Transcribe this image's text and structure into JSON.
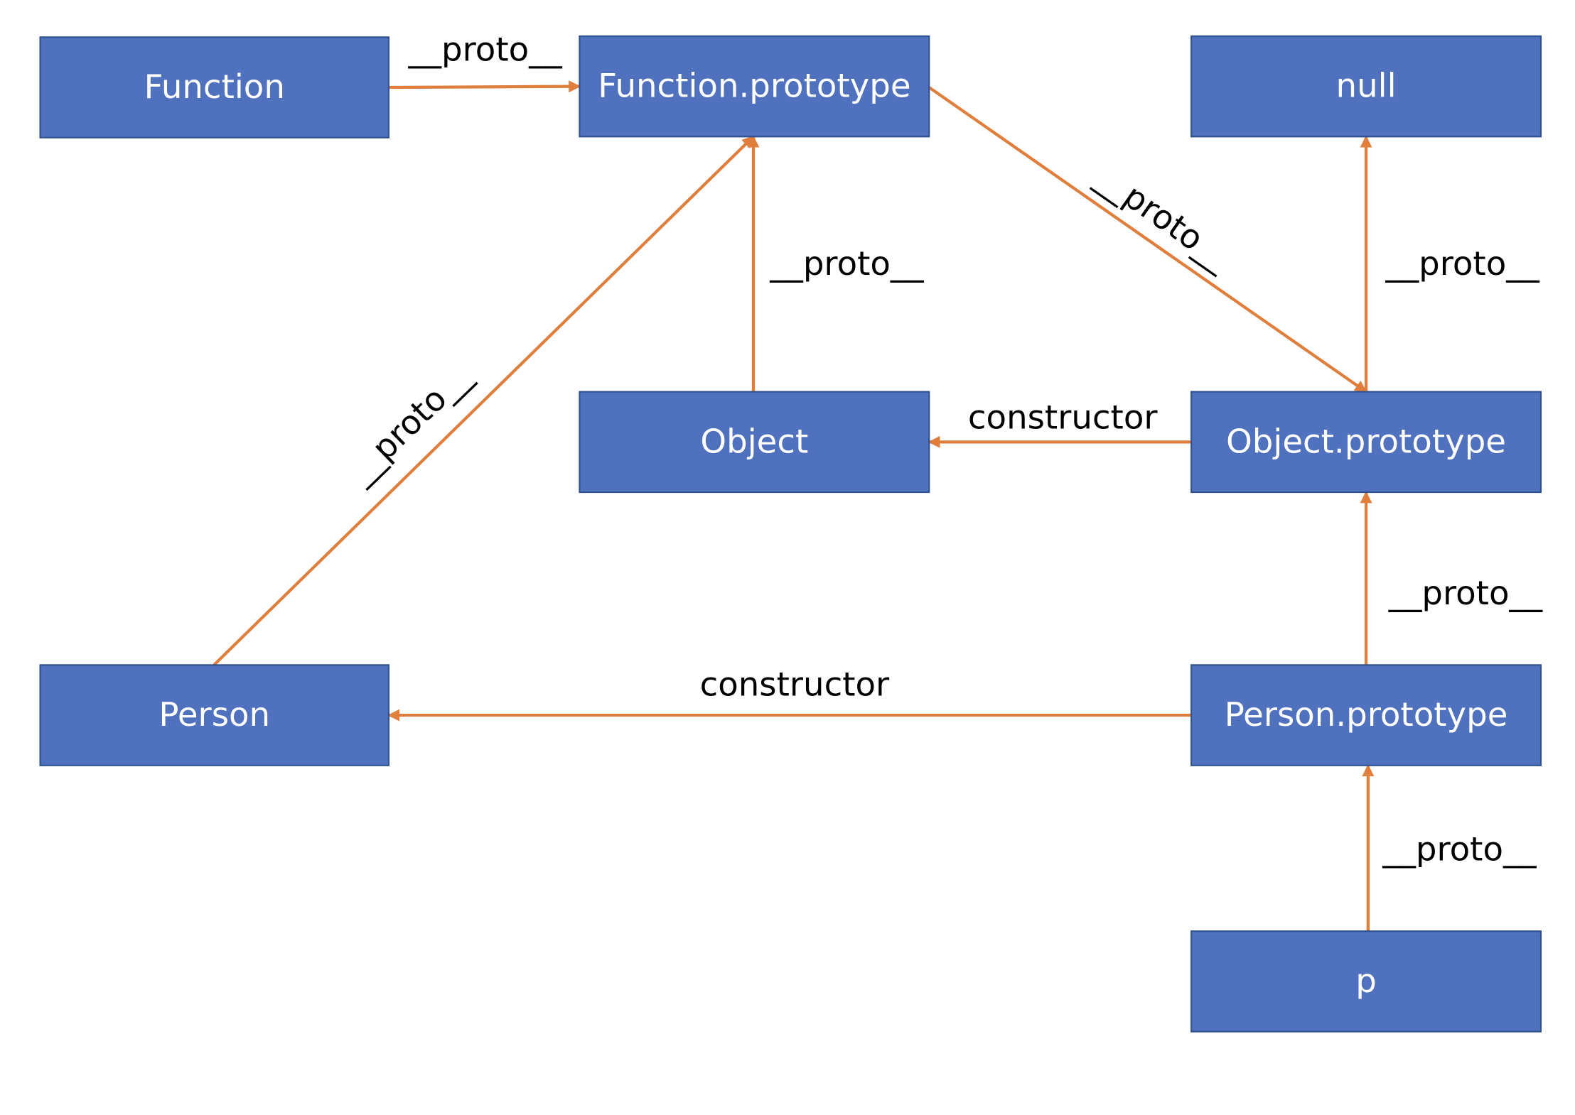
{
  "colors": {
    "box_fill": "#4F71BE",
    "box_border": "#2F528F",
    "arrow": "#E07E3C",
    "label": "#000000"
  },
  "nodes": [
    {
      "id": "function",
      "label": "Function"
    },
    {
      "id": "function_prototype",
      "label": "Function.prototype"
    },
    {
      "id": "null",
      "label": "null"
    },
    {
      "id": "object",
      "label": "Object"
    },
    {
      "id": "object_prototype",
      "label": "Object.prototype"
    },
    {
      "id": "person",
      "label": "Person"
    },
    {
      "id": "person_prototype",
      "label": "Person.prototype"
    },
    {
      "id": "p",
      "label": "p"
    }
  ],
  "edges": [
    {
      "from": "function",
      "to": "function_prototype",
      "label": "__proto__"
    },
    {
      "from": "function_prototype",
      "to": "object_prototype",
      "label": "__proto__"
    },
    {
      "from": "object",
      "to": "function_prototype",
      "label": "__proto__"
    },
    {
      "from": "person",
      "to": "function_prototype",
      "label": "__proto__"
    },
    {
      "from": "object_prototype",
      "to": "null",
      "label": "__proto__"
    },
    {
      "from": "object_prototype",
      "to": "object",
      "label": "constructor"
    },
    {
      "from": "person_prototype",
      "to": "object_prototype",
      "label": "__proto__"
    },
    {
      "from": "person_prototype",
      "to": "person",
      "label": "constructor"
    },
    {
      "from": "p",
      "to": "person_prototype",
      "label": "__proto__"
    }
  ]
}
